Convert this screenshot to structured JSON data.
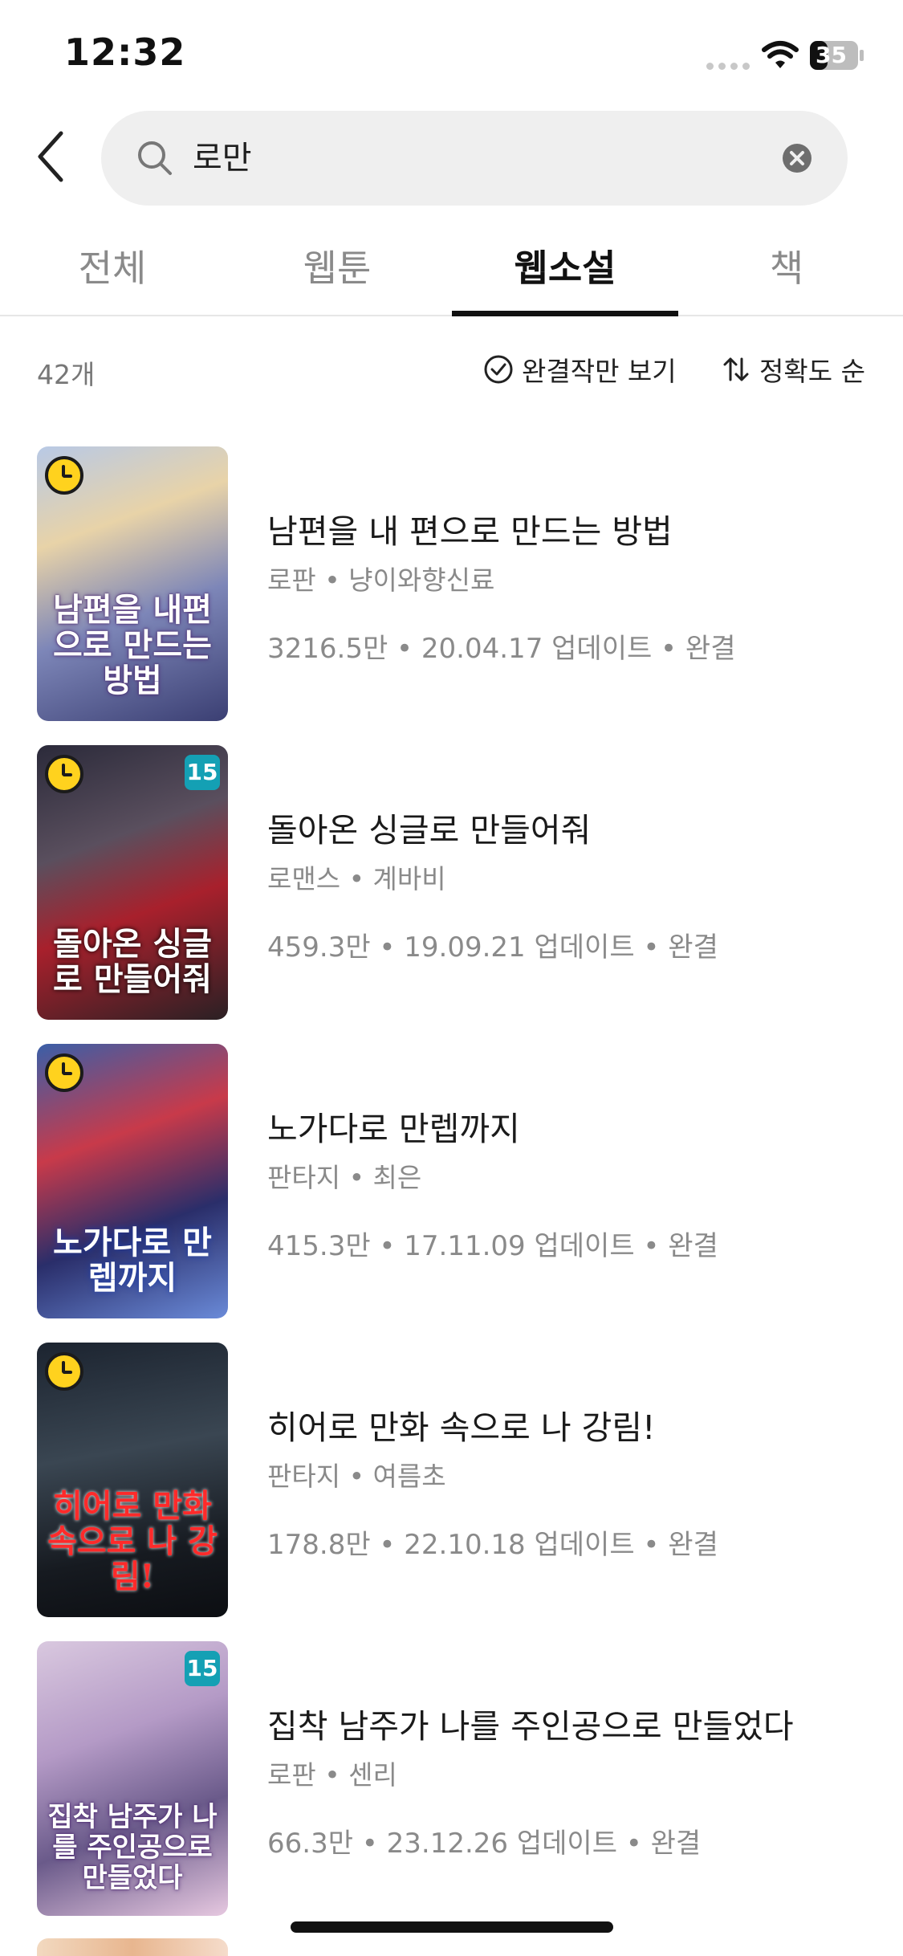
{
  "status_bar": {
    "time": "12:32",
    "battery": "35"
  },
  "search": {
    "query": "로만"
  },
  "tabs": [
    {
      "label": "전체",
      "active": false
    },
    {
      "label": "웹툰",
      "active": false
    },
    {
      "label": "웹소설",
      "active": true
    },
    {
      "label": "책",
      "active": false
    }
  ],
  "filters": {
    "count": "42개",
    "complete_only": "완결작만 보기",
    "sort": "정확도 순"
  },
  "results": [
    {
      "title": "남편을 내 편으로 만드는 방법",
      "meta": "로판 • 냥이와향신료",
      "stats": "3216.5만 • 20.04.17 업데이트 • 완결",
      "cover_text": "남편을 내편으로 만드는 방법",
      "wait_free": true,
      "age": ""
    },
    {
      "title": "돌아온 싱글로 만들어줘",
      "meta": "로맨스 • 계바비",
      "stats": "459.3만 • 19.09.21 업데이트 • 완결",
      "cover_text": "돌아온 싱글로 만들어줘",
      "wait_free": true,
      "age": "15"
    },
    {
      "title": "노가다로 만렙까지",
      "meta": "판타지 • 최은",
      "stats": "415.3만 • 17.11.09 업데이트 • 완결",
      "cover_text": "노가다로 만렙까지",
      "wait_free": true,
      "age": ""
    },
    {
      "title": "히어로 만화 속으로 나 강림!",
      "meta": "판타지 • 여름초",
      "stats": "178.8만 • 22.10.18 업데이트 • 완결",
      "cover_text": "히어로 만화 속으로 나 강림!",
      "wait_free": true,
      "age": ""
    },
    {
      "title": "집착 남주가 나를 주인공으로 만들었다",
      "meta": "로판 • 센리",
      "stats": "66.3만 • 23.12.26 업데이트 • 완결",
      "cover_text": "집착 남주가 나를 주인공으로 만들었다",
      "wait_free": false,
      "age": "15"
    }
  ]
}
